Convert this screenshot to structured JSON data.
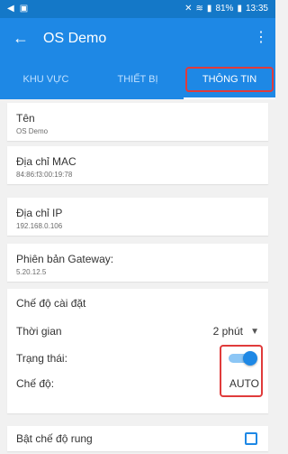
{
  "status": {
    "left_icons": [
      "back-icon",
      "gallery-icon"
    ],
    "right_text": "81%",
    "time": "13:35"
  },
  "appbar": {
    "title": "OS Demo",
    "back_icon": "back-arrow-icon",
    "menu_icon": "more-vert-icon"
  },
  "tabs": [
    {
      "label": "KHU VỰC"
    },
    {
      "label": "THIẾT BỊ"
    },
    {
      "label": "THÔNG TIN"
    }
  ],
  "info": {
    "name": {
      "label": "Tên",
      "value": "OS Demo"
    },
    "mac": {
      "label": "Địa chỉ MAC",
      "value": "84:86:f3:00:19:78"
    },
    "ip": {
      "label": "Địa chỉ IP",
      "value": "192.168.0.106"
    },
    "gateway": {
      "label": "Phiên bản Gateway:",
      "value": "5.20.12.5"
    }
  },
  "settings": {
    "title": "Chế độ cài đặt",
    "time_label": "Thời gian",
    "time_value": "2 phút",
    "status_label": "Trạng thái:",
    "status_on": true,
    "mode_label": "Chế độ:",
    "mode_value": "AUTO"
  },
  "vibration": {
    "label": "Bật chế độ rung",
    "checked": false
  },
  "colors": {
    "primary": "#1e88e5",
    "highlight": "#e03b3b"
  }
}
